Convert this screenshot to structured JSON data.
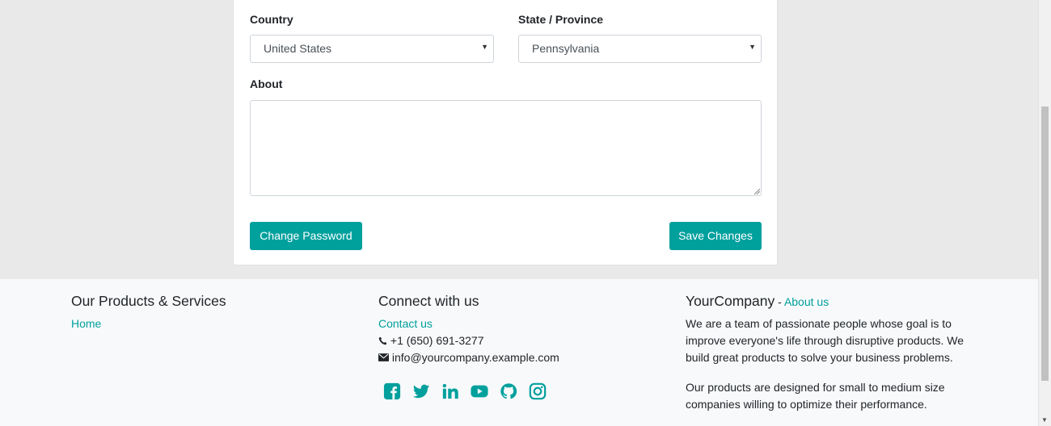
{
  "form": {
    "country_label": "Country",
    "country_value": "United States",
    "state_label": "State / Province",
    "state_value": "Pennsylvania",
    "about_label": "About",
    "about_value": "",
    "change_password_label": "Change Password",
    "save_changes_label": "Save Changes"
  },
  "footer": {
    "products_title": "Our Products & Services",
    "home_link": "Home",
    "connect_title": "Connect with us",
    "contact_link": "Contact us",
    "phone": "+1 (650) 691-3277",
    "email": "info@yourcompany.example.com",
    "company_name": "YourCompany",
    "company_sep": " - ",
    "about_link": "About us",
    "about_p1": "We are a team of passionate people whose goal is to improve everyone's life through disruptive products. We build great products to solve your business problems.",
    "about_p2": "Our products are designed for small to medium size companies willing to optimize their performance."
  },
  "social_icons": [
    "facebook-icon",
    "twitter-icon",
    "linkedin-icon",
    "youtube-icon",
    "github-icon",
    "instagram-icon"
  ],
  "colors": {
    "accent": "#00a09d",
    "background": "#e9e9e9",
    "footer": "#f8f9fa"
  }
}
